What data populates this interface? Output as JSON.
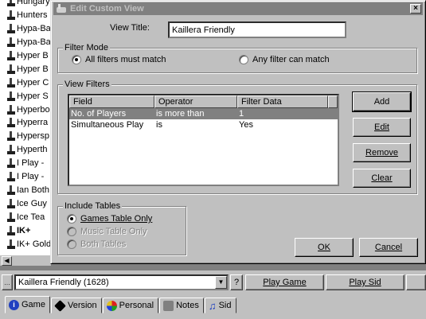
{
  "background": {
    "game_list": [
      {
        "label": "Hungary"
      },
      {
        "label": "Hunters"
      },
      {
        "label": "Hypa-Ba"
      },
      {
        "label": "Hypa-Ba"
      },
      {
        "label": "Hyper B"
      },
      {
        "label": "Hyper B"
      },
      {
        "label": "Hyper C"
      },
      {
        "label": "Hyper S"
      },
      {
        "label": "Hyperbo"
      },
      {
        "label": "Hyperra"
      },
      {
        "label": "Hypersp"
      },
      {
        "label": "Hyperth"
      },
      {
        "label": "I Play -"
      },
      {
        "label": "I Play -"
      },
      {
        "label": "Ian Both"
      },
      {
        "label": "Ice Guy"
      },
      {
        "label": "Ice Tea"
      },
      {
        "label": "IK+"
      },
      {
        "label": "IK+ Gold"
      }
    ],
    "view_combo_value": "Kaillera Friendly (1628)",
    "help_button_label": "?",
    "play_game_label": "Play Game",
    "play_sid_label": "Play Sid",
    "tabs": [
      {
        "label": "Game"
      },
      {
        "label": "Version"
      },
      {
        "label": "Personal"
      },
      {
        "label": "Notes"
      },
      {
        "label": "Sid"
      }
    ]
  },
  "dialog": {
    "title": "Edit Custom View",
    "close_label": "×",
    "view_title_label": "View Title:",
    "view_title_value": "Kaillera Friendly",
    "filter_mode": {
      "group_label": "Filter Mode",
      "option_all": "All filters must match",
      "option_any": "Any filter can match",
      "selected": "all"
    },
    "view_filters": {
      "group_label": "View Filters",
      "columns": [
        "Field",
        "Operator",
        "Filter Data"
      ],
      "rows": [
        {
          "field": "No. of Players",
          "operator": "is more than",
          "data": "1"
        },
        {
          "field": "Simultaneous Play",
          "operator": "is",
          "data": "Yes"
        }
      ]
    },
    "buttons": {
      "add": "Add",
      "edit": "Edit",
      "remove": "Remove",
      "clear": "Clear",
      "ok": "OK",
      "cancel": "Cancel"
    },
    "include_tables": {
      "group_label": "Include Tables",
      "option_games": "Games Table Only",
      "option_music": "Music Table Only",
      "option_both": "Both Tables",
      "selected": "games"
    }
  }
}
